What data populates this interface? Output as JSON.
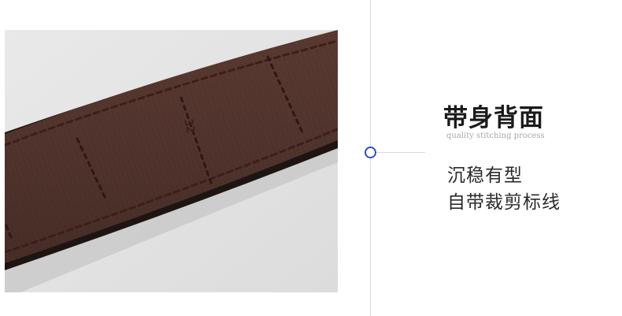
{
  "image": {
    "subject": "belt-back-leather-photo",
    "stamp": "32",
    "colors": {
      "background": "#e6e6e6",
      "leather": "#5b3a32",
      "stitch": "#3b1f18",
      "edge": "#1e1512"
    }
  },
  "text": {
    "heading": "带身背面",
    "subheading": "quality stitching process",
    "line1": "沉稳有型",
    "line2": "自带裁剪标线"
  },
  "colors": {
    "accent": "#2b50c9",
    "divider": "#d8dbe3",
    "heading": "#1a1a1a",
    "subheading": "#a9a9a9",
    "body": "#2a2a2a"
  }
}
